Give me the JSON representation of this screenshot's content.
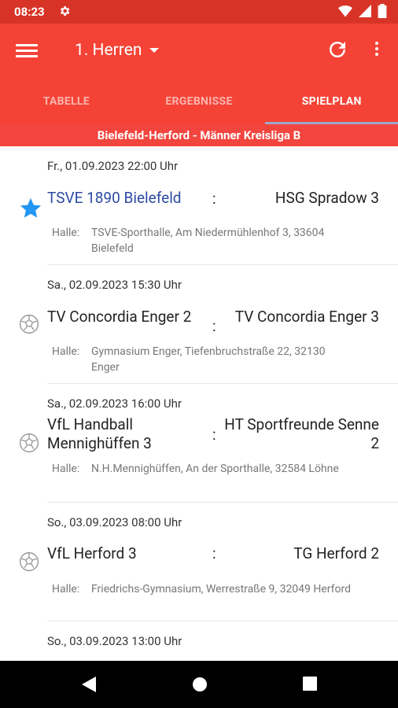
{
  "statusbar": {
    "time": "08:23"
  },
  "appbar": {
    "title": "1. Herren"
  },
  "tabs": [
    {
      "label": "TABELLE"
    },
    {
      "label": "ERGEBNISSE"
    },
    {
      "label": "SPIELPLAN"
    }
  ],
  "league": "Bielefeld-Herford - Männer Kreisliga B",
  "hall_label": "Halle:",
  "matches": [
    {
      "date": "Fr., 01.09.2023 22:00 Uhr",
      "home": "TSVE 1890 Bielefeld",
      "away": "HSG Spradow 3",
      "hall": "TSVE-Sporthalle, Am Niedermühlenhof 3, 33604 Bielefeld",
      "icon": "star-icon"
    },
    {
      "date": "Sa., 02.09.2023 15:30 Uhr",
      "home": "TV Concordia Enger 2",
      "away": "TV Concordia Enger 3",
      "hall": "Gymnasium Enger, Tiefenbruchstraße 22, 32130 Enger",
      "icon": "handball-icon"
    },
    {
      "date": "Sa., 02.09.2023 16:00 Uhr",
      "home": "VfL Handball Mennighüffen 3",
      "away": "HT Sportfreunde Senne 2",
      "hall": "N.H.Mennighüffen, An der Sporthalle, 32584 Löhne",
      "icon": "handball-icon"
    },
    {
      "date": "So., 03.09.2023 08:00 Uhr",
      "home": "VfL Herford 3",
      "away": "TG Herford 2",
      "hall": "Friedrichs-Gymnasium, Werrestraße 9, 32049 Herford",
      "icon": "handball-icon"
    },
    {
      "date": "So., 03.09.2023 13:00 Uhr"
    }
  ],
  "colors": {
    "primary": "#f44336",
    "statusbar": "#d73427",
    "link": "#2c4aa1",
    "star": "#2196f3"
  }
}
